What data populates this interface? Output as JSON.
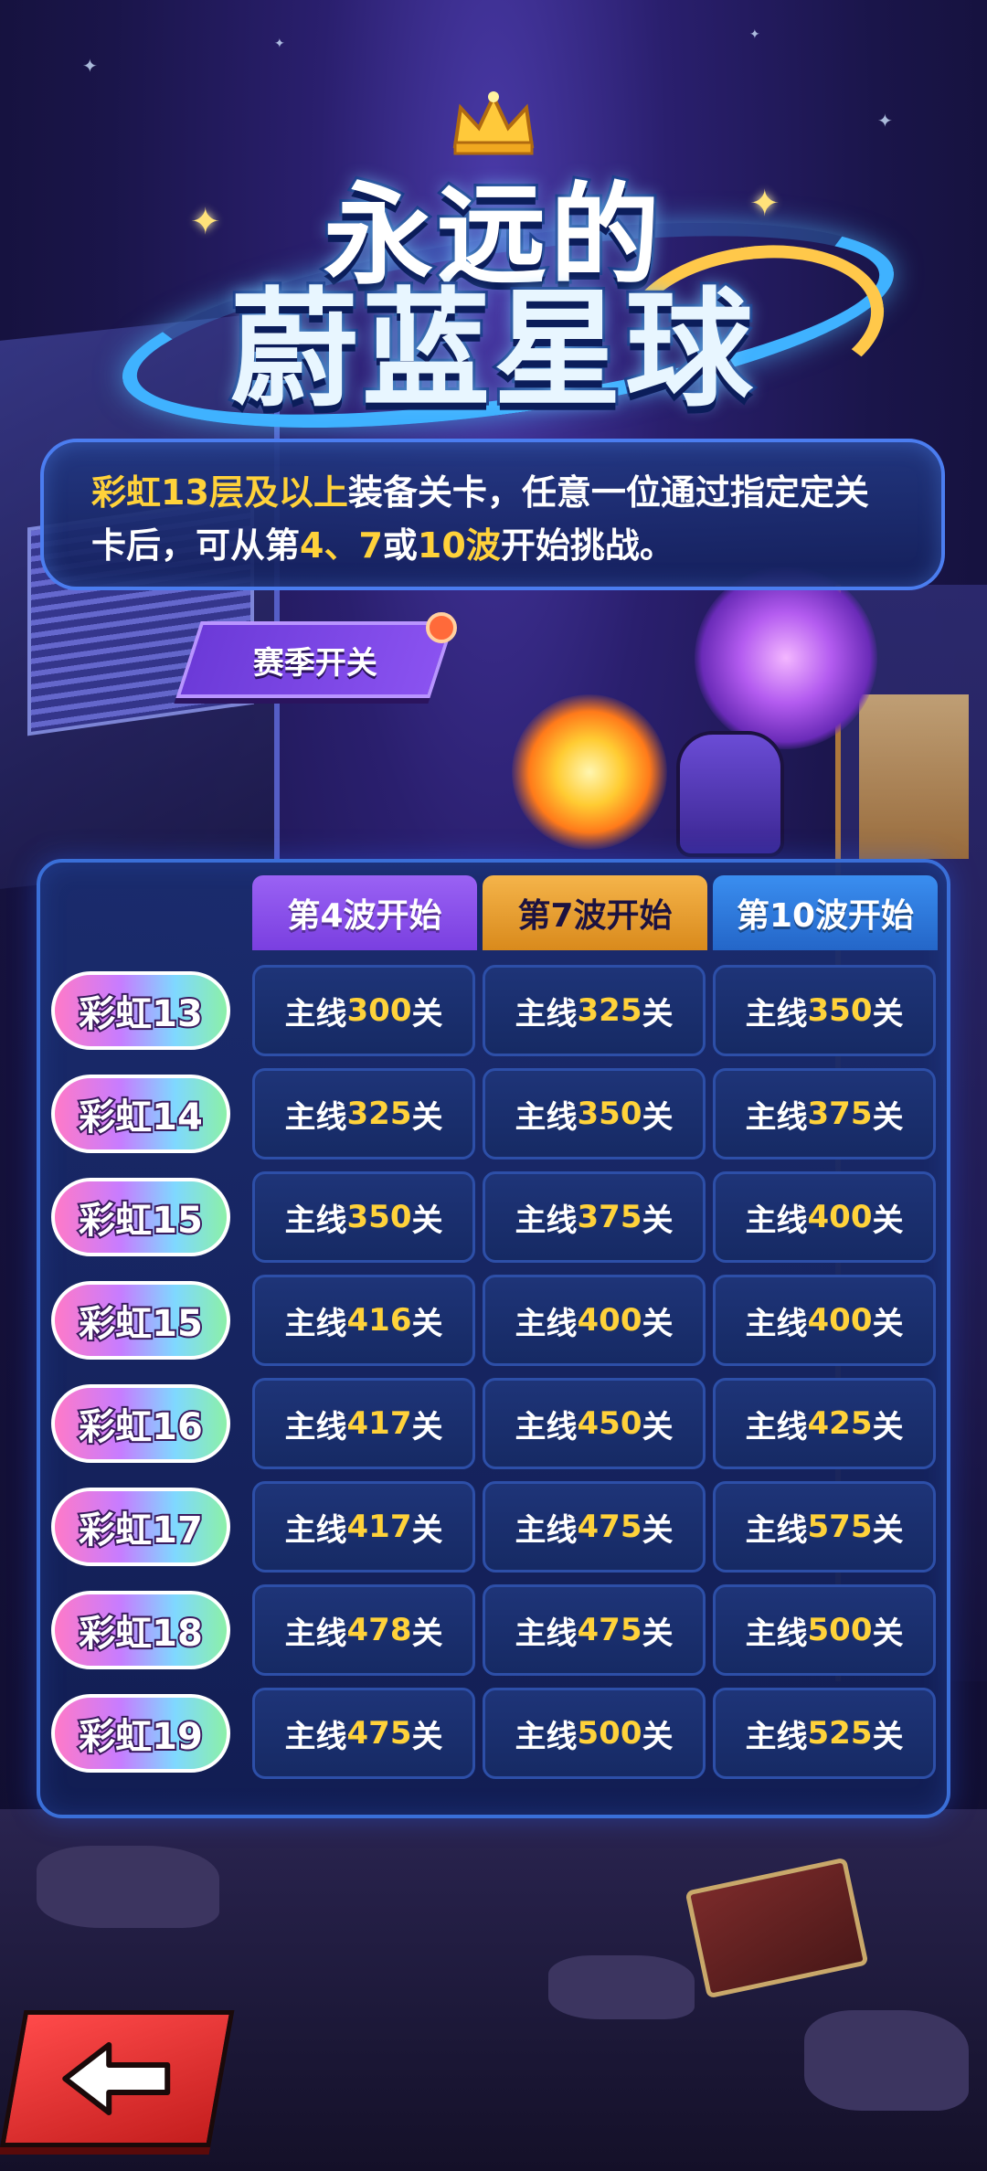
{
  "title": {
    "line1": "永远的",
    "line2": "蔚蓝星球"
  },
  "info": {
    "part1": "彩虹13层及以上",
    "part2": "装备关卡，任意一位通过指定定关卡后，可从第",
    "part3": "4、7",
    "part4": "或",
    "part5": "10波",
    "part6": "开始挑战。"
  },
  "season_toggle": {
    "label": "赛季开关"
  },
  "table": {
    "headers": [
      "第4波开始",
      "第7波开始",
      "第10波开始"
    ],
    "prefix": "主线",
    "suffix": "关",
    "rows": [
      {
        "label": "彩虹13",
        "values": [
          "300",
          "325",
          "350"
        ]
      },
      {
        "label": "彩虹14",
        "values": [
          "325",
          "350",
          "375"
        ]
      },
      {
        "label": "彩虹15",
        "values": [
          "350",
          "375",
          "400"
        ]
      },
      {
        "label": "彩虹15",
        "values": [
          "416",
          "400",
          "400"
        ]
      },
      {
        "label": "彩虹16",
        "values": [
          "417",
          "450",
          "425"
        ]
      },
      {
        "label": "彩虹17",
        "values": [
          "417",
          "475",
          "575"
        ]
      },
      {
        "label": "彩虹18",
        "values": [
          "478",
          "475",
          "500"
        ]
      },
      {
        "label": "彩虹19",
        "values": [
          "475",
          "500",
          "525"
        ]
      }
    ]
  },
  "icons": {
    "back": "arrow-left-icon",
    "crown": "crown-icon",
    "sparkle": "sparkle-icon"
  },
  "colors": {
    "highlight": "#ffd23a",
    "panel_border": "#3a6fd8",
    "back_button": "#e32b2b"
  }
}
